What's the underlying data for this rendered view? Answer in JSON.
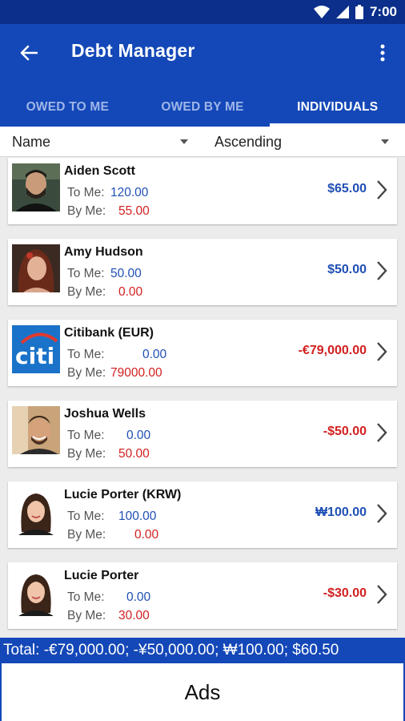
{
  "status": {
    "time": "7:00"
  },
  "app": {
    "title": "Debt Manager"
  },
  "tabs": [
    {
      "label": "OWED TO ME",
      "active": false
    },
    {
      "label": "OWED BY ME",
      "active": false
    },
    {
      "label": "INDIVIDUALS",
      "active": true
    }
  ],
  "sort": {
    "field": "Name",
    "order": "Ascending"
  },
  "labels": {
    "to_me": "To Me:",
    "by_me": "By Me:"
  },
  "people": [
    {
      "name": "Aiden Scott",
      "to_me": "120.00",
      "by_me": "55.00",
      "balance": "$65.00",
      "balance_color": "blue",
      "avatar": "man-dark-beard-photo"
    },
    {
      "name": "Amy Hudson",
      "to_me": "50.00",
      "by_me": "0.00",
      "balance": "$50.00",
      "balance_color": "blue",
      "avatar": "woman-red-hair-photo"
    },
    {
      "name": "Citibank (EUR)",
      "to_me": "0.00",
      "by_me": "79000.00",
      "balance": "-€79,000.00",
      "balance_color": "red",
      "avatar": "citi-logo"
    },
    {
      "name": "Joshua Wells",
      "to_me": "0.00",
      "by_me": "50.00",
      "balance": "-$50.00",
      "balance_color": "red",
      "avatar": "man-smiling-photo"
    },
    {
      "name": "Lucie Porter (KRW)",
      "to_me": "100.00",
      "by_me": "0.00",
      "balance": "₩100.00",
      "balance_color": "blue",
      "avatar": "woman-brown-hair-photo"
    },
    {
      "name": "Lucie Porter",
      "to_me": "0.00",
      "by_me": "30.00",
      "balance": "-$30.00",
      "balance_color": "red",
      "avatar": "woman-brown-hair-photo"
    }
  ],
  "total": "Total: -€79,000.00; -¥50,000.00; ₩100.00; $60.50",
  "ads": {
    "label": "Ads"
  },
  "colors": {
    "primary": "#1448b8",
    "status_bar": "#0b2f8a",
    "positive": "#1f4fb5",
    "negative": "#d22020"
  }
}
